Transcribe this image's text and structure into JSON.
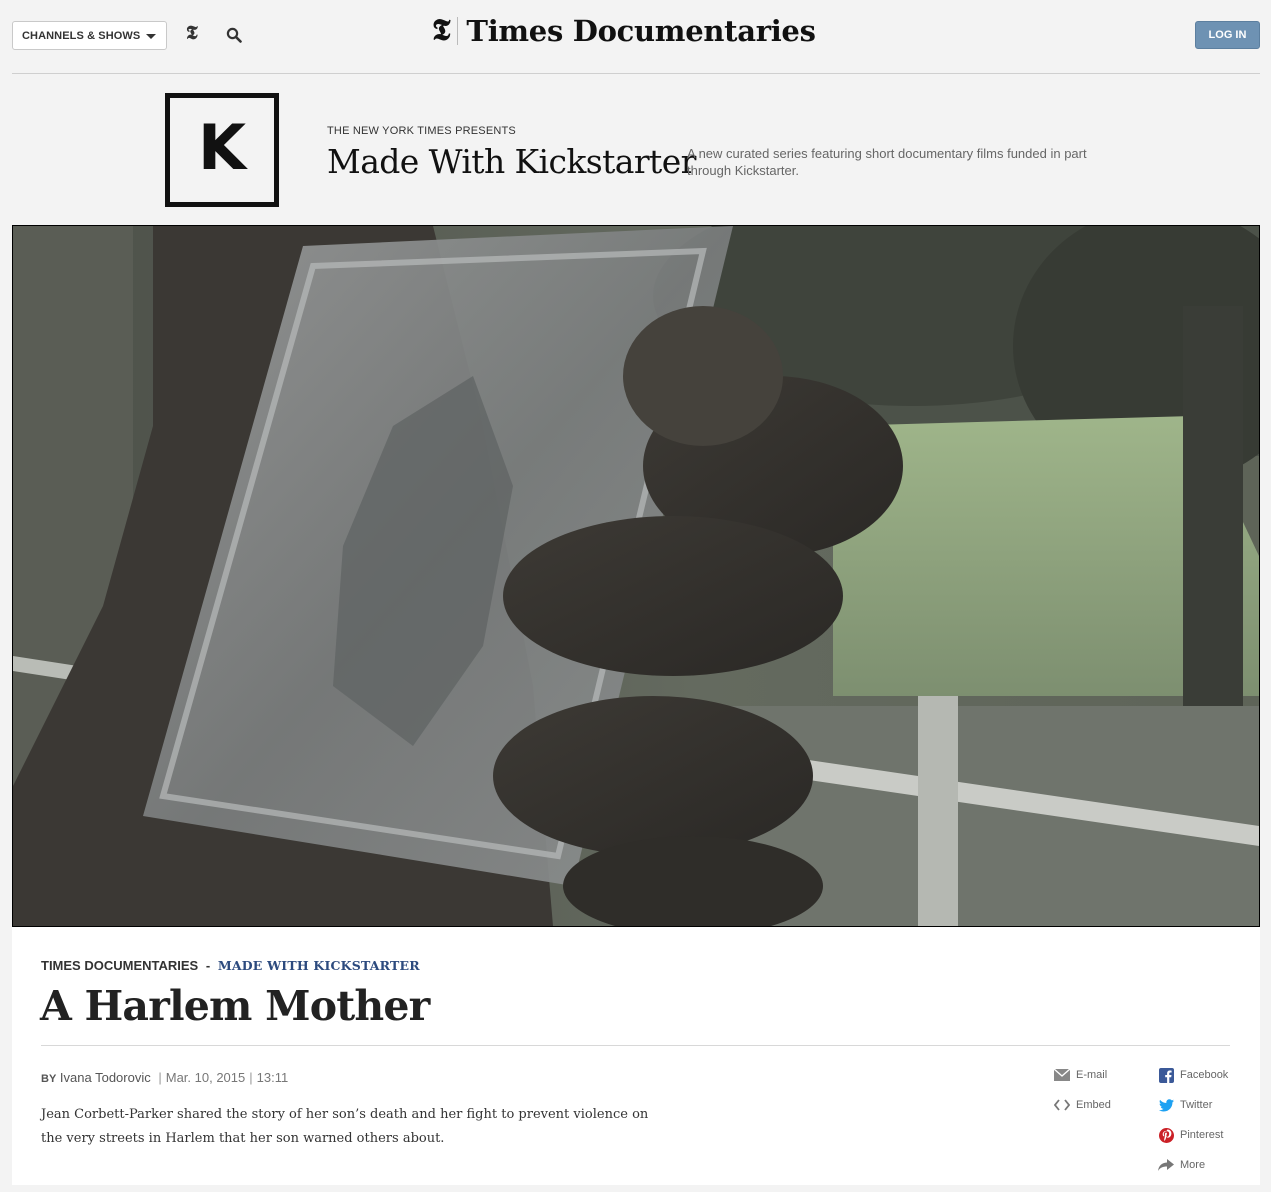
{
  "header": {
    "channels_label": "CHANNELS & SHOWS",
    "nyt_logo_glyph": "𝕿",
    "brand_glyph": "𝕿",
    "brand_name": "Times Documentaries",
    "login_label": "LOG IN"
  },
  "series": {
    "logo_letter": "K",
    "presents": "THE NEW YORK TIMES PRESENTS",
    "title": "Made With Kickstarter",
    "description": "A new curated series featuring short documentary films funded in part through Kickstarter."
  },
  "article": {
    "kicker_section": "TIMES DOCUMENTARIES",
    "kicker_dash": "-",
    "kicker_series": "MADE WITH KICKSTARTER",
    "headline": "A Harlem Mother",
    "by": "BY",
    "author": "Ivana Todorovic",
    "date": "Mar. 10, 2015",
    "duration": "13:11",
    "summary": "Jean Corbett-Parker shared the story of her son’s death and her fight to prevent violence on the very streets in Harlem that her son warned others about."
  },
  "share": {
    "email": "E-mail",
    "embed": "Embed",
    "facebook": "Facebook",
    "twitter": "Twitter",
    "pinterest": "Pinterest",
    "more": "More"
  },
  "colors": {
    "login_bg": "#6e92b3",
    "series_link": "#2c4a7e",
    "facebook": "#3b5998",
    "twitter": "#1da1f2",
    "pinterest": "#cb2027"
  }
}
